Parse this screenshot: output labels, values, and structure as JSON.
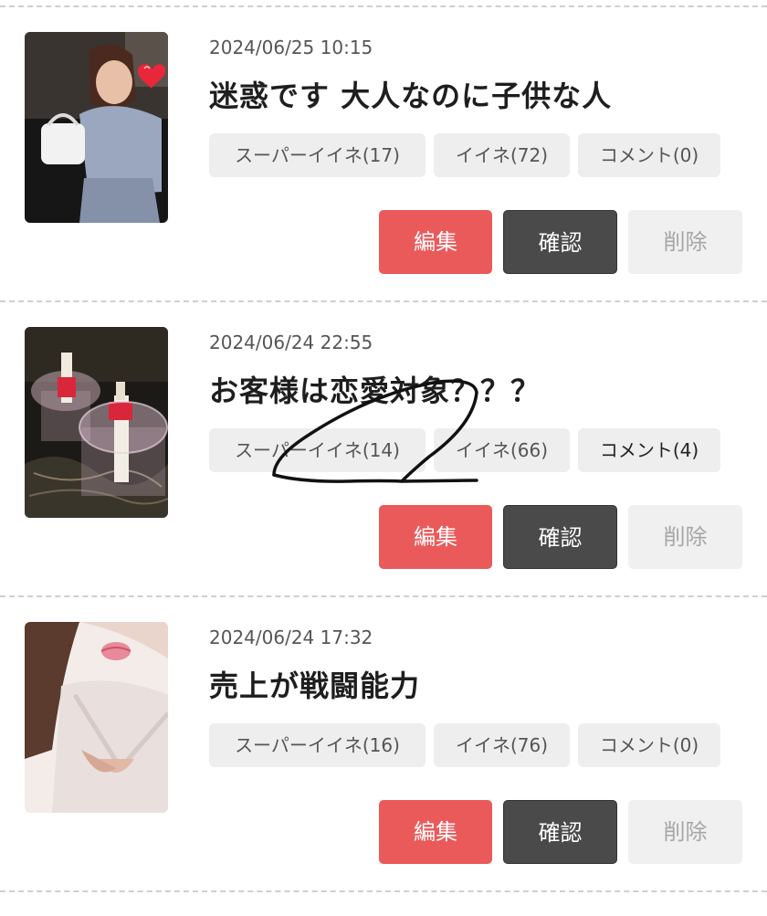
{
  "posts": [
    {
      "date": "2024/06/25 10:15",
      "title": "迷惑です 大人なのに子供な人",
      "super_like": "スーパーイイネ(17)",
      "like": "イイネ(72)",
      "comment": "コメント(0)",
      "edit_label": "編集",
      "check_label": "確認",
      "delete_label": "削除"
    },
    {
      "date": "2024/06/24 22:55",
      "title": "お客様は恋愛対象？？？",
      "super_like": "スーパーイイネ(14)",
      "like": "イイネ(66)",
      "comment": "コメント(4)",
      "edit_label": "編集",
      "check_label": "確認",
      "delete_label": "削除"
    },
    {
      "date": "2024/06/24 17:32",
      "title": "売上が戦闘能力",
      "super_like": "スーパーイイネ(16)",
      "like": "イイネ(76)",
      "comment": "コメント(0)",
      "edit_label": "編集",
      "check_label": "確認",
      "delete_label": "削除"
    }
  ],
  "colors": {
    "edit_button": "#ea5a5a",
    "check_button": "#4a4a4a",
    "delete_button": "#f0f0f0",
    "tag_background": "#eeeeee"
  }
}
